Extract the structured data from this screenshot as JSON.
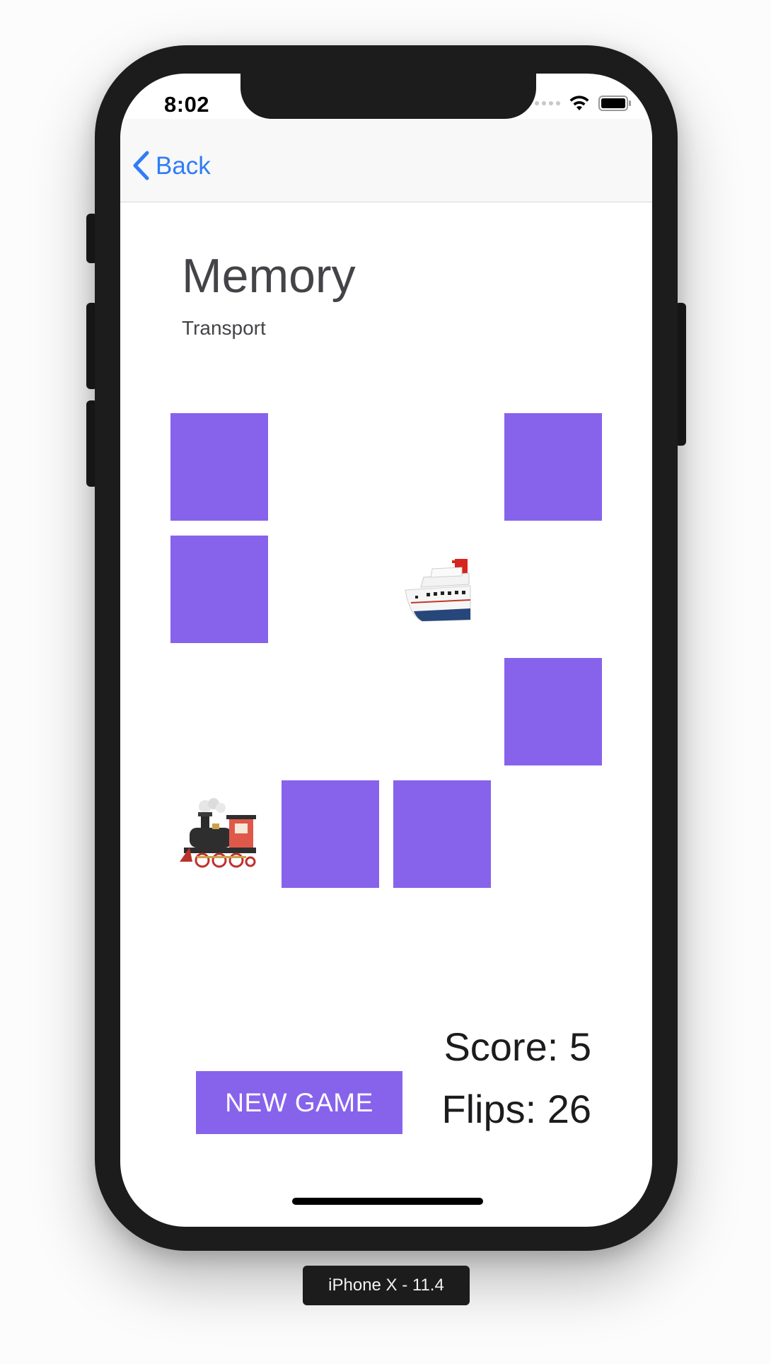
{
  "status_bar": {
    "time": "8:02",
    "icons": [
      "cellular-signal-icon",
      "wifi-icon",
      "battery-icon"
    ]
  },
  "nav": {
    "back_label": "Back",
    "back_icon": "chevron-left-icon",
    "accent_color": "#2f7df6"
  },
  "game": {
    "title": "Memory",
    "theme": "Transport",
    "card_color": "#8763ec",
    "cards": [
      {
        "state": "face-down"
      },
      {
        "state": "face-down"
      },
      {
        "state": "face-down"
      },
      {
        "state": "face-up",
        "content": "ship-icon"
      },
      {
        "state": "face-down"
      },
      {
        "state": "face-up",
        "content": "locomotive-icon"
      },
      {
        "state": "face-down"
      },
      {
        "state": "face-down"
      }
    ]
  },
  "controls": {
    "new_game_label": "NEW GAME"
  },
  "stats": {
    "score_text": "Score: 5",
    "flips_text": "Flips: 26"
  },
  "simulator": {
    "device_label": "iPhone X - 11.4"
  }
}
